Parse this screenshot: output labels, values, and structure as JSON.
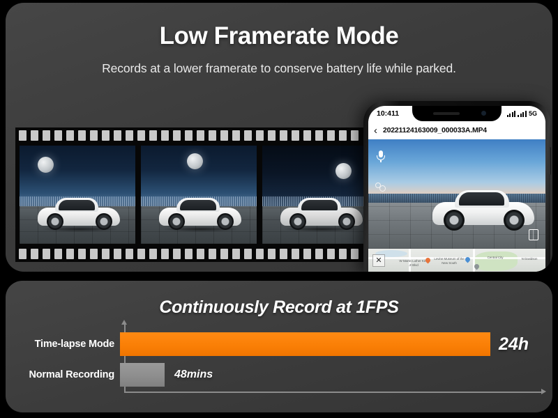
{
  "header": {
    "title": "Low Framerate Mode",
    "subtitle": "Records at a lower framerate to conserve battery life while parked."
  },
  "filmstrip": {
    "name": "film-strip",
    "frames": [
      {
        "alt": "White car parked at night with moon, frame 1"
      },
      {
        "alt": "White car parked at night with moon, frame 2"
      },
      {
        "alt": "White car parked at night with moon, frame 3"
      }
    ]
  },
  "phone": {
    "status": {
      "time": "10:411",
      "network": "5G"
    },
    "nav": {
      "back": "‹",
      "filename": "20221124163009_000033A.MP4"
    },
    "icons": {
      "mic": "microphone-icon",
      "gear": "settings-icon",
      "doc": "document-icon"
    },
    "map": {
      "close": "✕",
      "labels": [
        "W Martin Luther King Jr Blvd",
        "Levine Museum of the New South",
        "Central City",
        "N Davidson"
      ]
    }
  },
  "chart_data": {
    "type": "bar",
    "title": "Continuously Record at 1FPS",
    "orientation": "horizontal",
    "categories": [
      "Time-lapse Mode",
      "Normal Recording"
    ],
    "values": [
      1440,
      48
    ],
    "value_labels": [
      "24h",
      "48mins"
    ],
    "unit": "minutes",
    "xlabel": "",
    "ylabel": "",
    "xlim": [
      0,
      1440
    ],
    "grid": false,
    "legend": false,
    "colors": {
      "bar_timelapse": "#fa7f06",
      "bar_normal": "#8e8e8e",
      "axis": "#8c8c8c",
      "text": "#ffffff",
      "panel_bg": "#3c3c3c"
    }
  }
}
